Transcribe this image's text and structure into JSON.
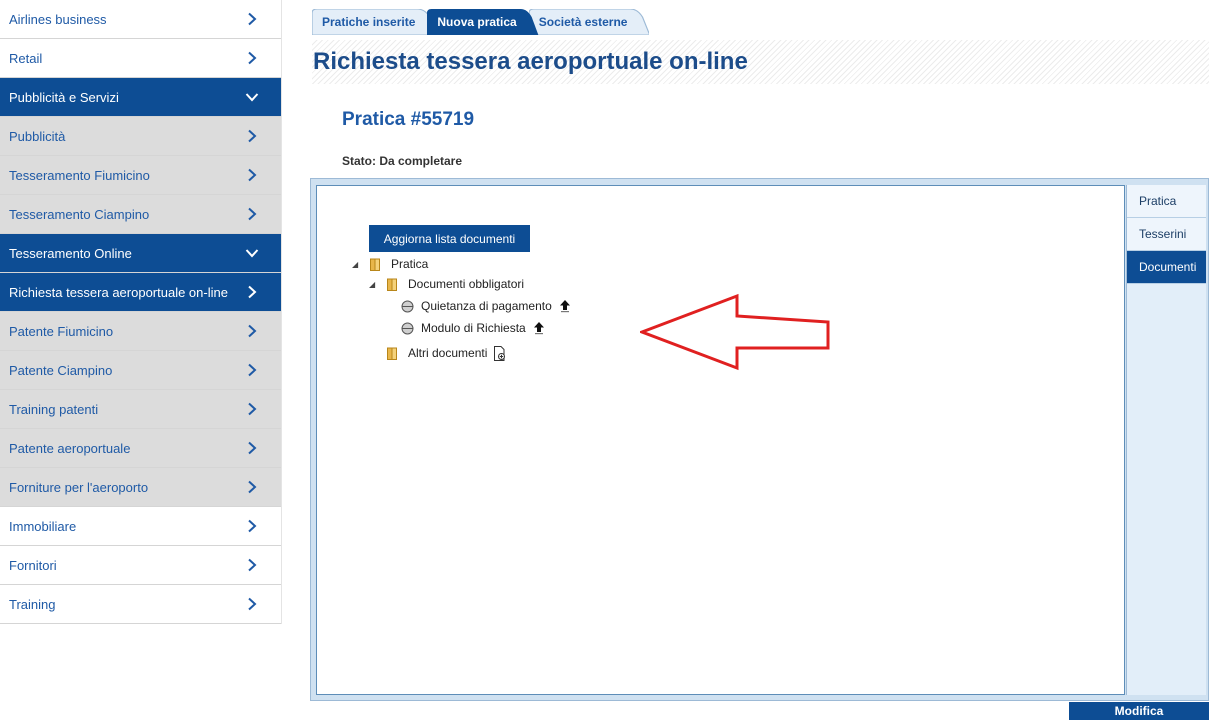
{
  "sidebar": {
    "items": [
      {
        "label": "Airlines business",
        "chevron": "chevron-right-icon"
      },
      {
        "label": "Retail",
        "chevron": "chevron-right-icon"
      },
      {
        "label": "Pubblicità e Servizi",
        "chevron": "chevron-down-icon"
      },
      {
        "label": "Pubblicità",
        "chevron": "chevron-right-icon"
      },
      {
        "label": "Tesseramento Fiumicino",
        "chevron": "chevron-right-icon"
      },
      {
        "label": "Tesseramento Ciampino",
        "chevron": "chevron-right-icon"
      },
      {
        "label": "Tesseramento Online",
        "chevron": "chevron-down-icon"
      },
      {
        "label": "Richiesta tessera aeroportuale on-line",
        "chevron": "chevron-right-icon"
      },
      {
        "label": "Patente Fiumicino",
        "chevron": "chevron-right-icon"
      },
      {
        "label": "Patente Ciampino",
        "chevron": "chevron-right-icon"
      },
      {
        "label": "Training patenti",
        "chevron": "chevron-right-icon"
      },
      {
        "label": "Patente aeroportuale",
        "chevron": "chevron-right-icon"
      },
      {
        "label": "Forniture per l'aeroporto",
        "chevron": "chevron-right-icon"
      },
      {
        "label": "Immobiliare",
        "chevron": "chevron-right-icon"
      },
      {
        "label": "Fornitori",
        "chevron": "chevron-right-icon"
      },
      {
        "label": "Training",
        "chevron": "chevron-right-icon"
      }
    ]
  },
  "tabs": [
    {
      "label": "Pratiche inserite"
    },
    {
      "label": "Nuova pratica"
    },
    {
      "label": "Società esterne"
    }
  ],
  "page_title": "Richiesta tessera aeroportuale on-line",
  "pratica_title": "Pratica #55719",
  "stato": "Stato: Da completare",
  "panel": {
    "refresh_button": "Aggiorna lista documenti",
    "tree": {
      "root": "Pratica",
      "mandatory_folder": "Documenti obbligatori",
      "doc1": "Quietanza di pagamento",
      "doc2": "Modulo di Richiesta",
      "other_folder": "Altri documenti"
    },
    "side_tabs": [
      {
        "label": "Pratica"
      },
      {
        "label": "Tesserini"
      },
      {
        "label": "Documenti"
      }
    ]
  },
  "modifica_button": "Modifica",
  "colors": {
    "primary": "#0d4d94",
    "link": "#1f5aa6",
    "annotation_arrow": "#e02020"
  }
}
